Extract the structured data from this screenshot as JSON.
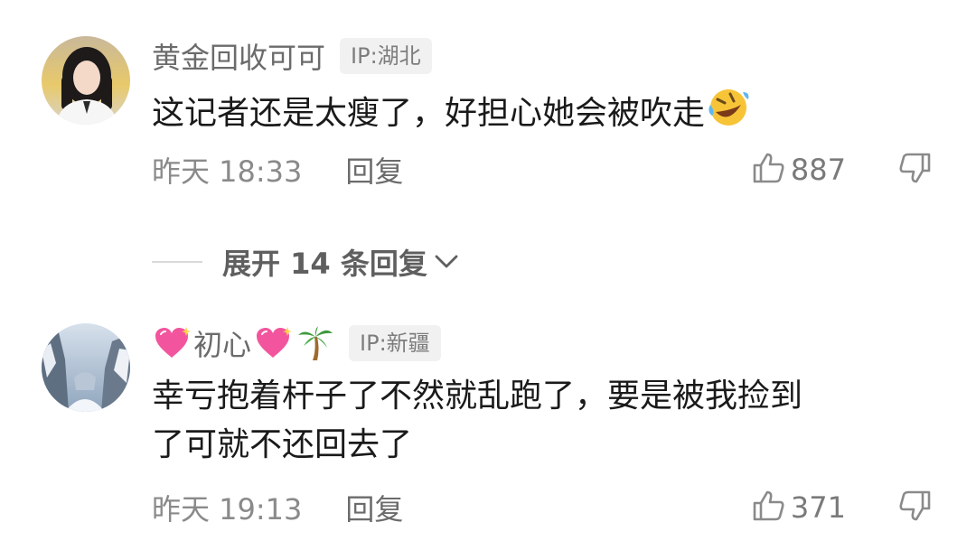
{
  "comments": [
    {
      "username": "黄金回收可可",
      "ip": "IP:湖北",
      "text": "这记者还是太瘦了，好担心她会被吹走",
      "emoji_after_text": "rolling-on-floor-laughing-emoji",
      "time": "昨天 18:33",
      "reply_label": "回复",
      "likes": "887"
    },
    {
      "username": "初心",
      "username_emojis": [
        "sparkling-heart-emoji",
        "sparkling-heart-emoji",
        "palm-tree-emoji"
      ],
      "ip": "IP:新疆",
      "text_lines": [
        "幸亏抱着杆子了不然就乱跑了，要是被我捡到",
        "了可就不还回去了"
      ],
      "time": "昨天 19:13",
      "reply_label": "回复",
      "likes": "371"
    }
  ],
  "expand_replies": {
    "label": "展开 14 条回复"
  },
  "icons": {
    "like": "thumbs-up-outline-icon",
    "dislike": "thumbs-down-outline-icon",
    "expand": "chevron-down-icon"
  },
  "colors": {
    "text_primary": "#1a1a1a",
    "text_secondary": "#8a8a8a",
    "ip_tag_bg": "#f1f1f1"
  }
}
